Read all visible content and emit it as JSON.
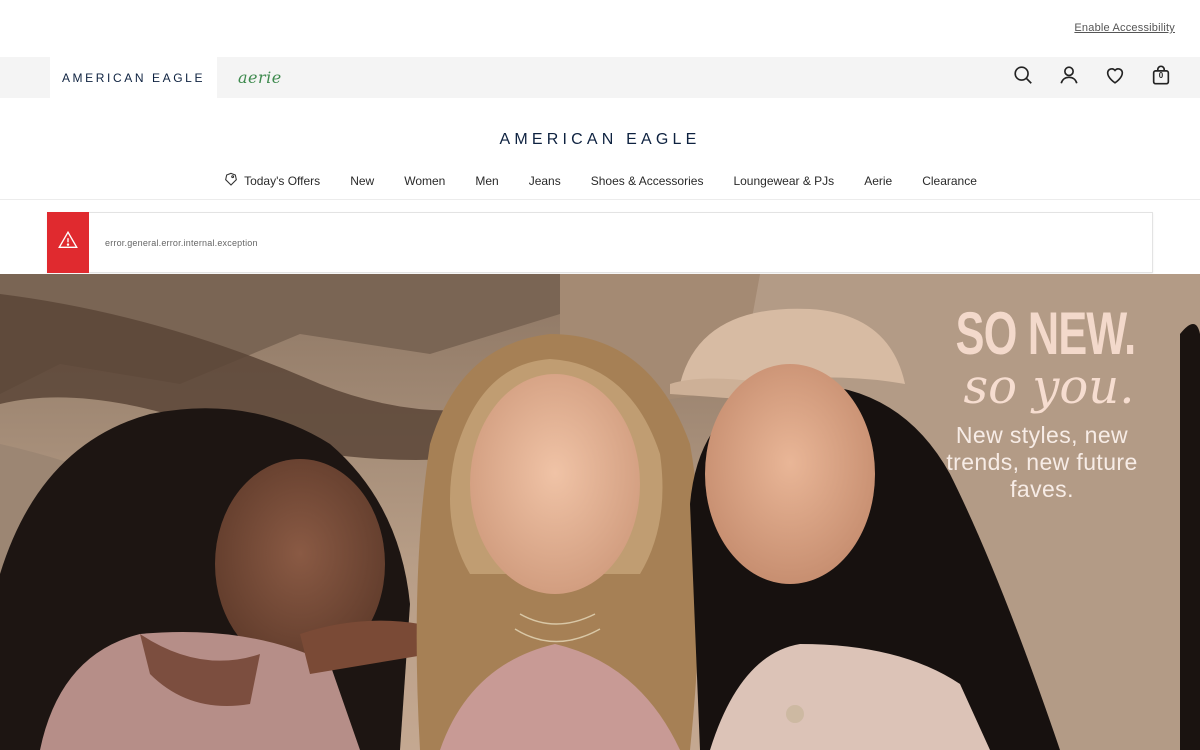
{
  "accessibility": {
    "link_label": "Enable Accessibility"
  },
  "brand_bar": {
    "tabs": [
      {
        "label": "AMERICAN EAGLE",
        "active": true
      },
      {
        "label": "aerie",
        "active": false
      }
    ],
    "icons": [
      "search-icon",
      "account-icon",
      "wishlist-heart-icon",
      "shopping-bag-icon"
    ],
    "bag_count": "0"
  },
  "header": {
    "logo": "AMERICAN EAGLE",
    "nav": [
      {
        "label": "Today's Offers",
        "icon": "offer-tag-icon"
      },
      {
        "label": "New"
      },
      {
        "label": "Women"
      },
      {
        "label": "Men"
      },
      {
        "label": "Jeans"
      },
      {
        "label": "Shoes & Accessories"
      },
      {
        "label": "Loungewear & PJs"
      },
      {
        "label": "Aerie"
      },
      {
        "label": "Clearance"
      }
    ]
  },
  "error_banner": {
    "icon": "warning-triangle-icon",
    "message": "error.general.error.internal.exception",
    "accent": "#e02a2f"
  },
  "hero": {
    "headline": "SO NEW.",
    "script": "so you.",
    "subtext": "New styles, new trends, new future faves."
  },
  "colors": {
    "brand_navy": "#0e2240",
    "aerie_green": "#3e8a4e",
    "hero_text": "#f3d9cb"
  }
}
